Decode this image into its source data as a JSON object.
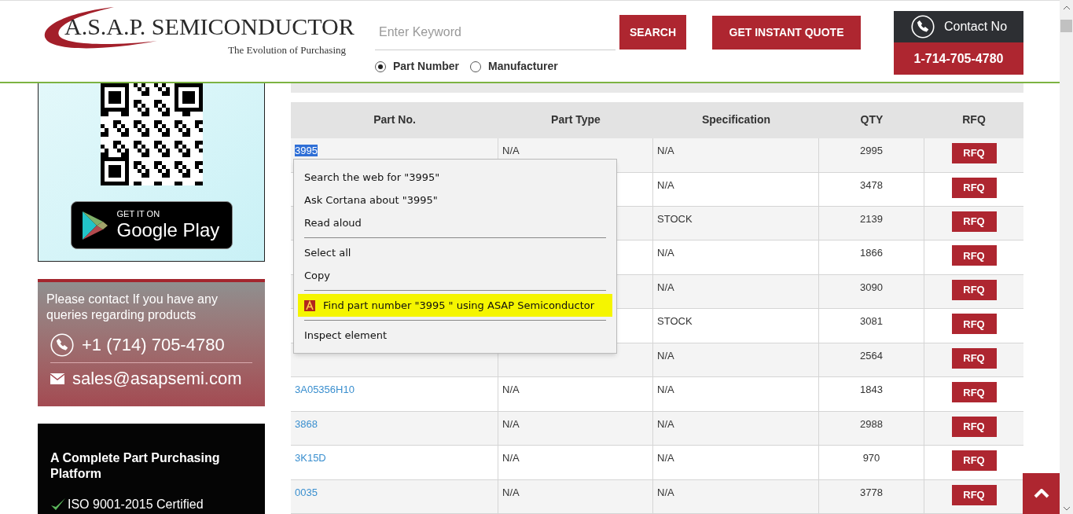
{
  "header": {
    "logo": {
      "name": "A.S.A.P. SEMICONDUCTOR",
      "tagline": "The Evolution of Purchasing"
    },
    "search": {
      "placeholder": "Enter Keyword",
      "button": "SEARCH",
      "options": [
        {
          "label": "Part Number",
          "selected": true
        },
        {
          "label": "Manufacturer",
          "selected": false
        }
      ]
    },
    "quote_button": "GET INSTANT QUOTE",
    "contact": {
      "label": "Contact No",
      "phone": "1-714-705-4780"
    }
  },
  "sidebar": {
    "app_badge": {
      "small": "GET IT ON",
      "large": "Google Play"
    },
    "contact_card": {
      "text": "Please contact If you have any queries regarding products",
      "phone": "+1 (714) 705-4780",
      "email": "sales@asapsemi.com"
    },
    "promo_card": {
      "title": "A Complete Part Purchasing Platform",
      "items": [
        "ISO 9001-2015 Certified"
      ]
    }
  },
  "table": {
    "columns": [
      "Part No.",
      "Part Type",
      "Specification",
      "QTY",
      "RFQ"
    ],
    "rows": [
      {
        "part": "3995",
        "part_selected": true,
        "type": "N/A",
        "spec": "N/A",
        "qty": "2995",
        "rfq": "RFQ"
      },
      {
        "spec": "N/A",
        "qty": "3478",
        "rfq": "RFQ"
      },
      {
        "spec": "STOCK",
        "qty": "2139",
        "rfq": "RFQ"
      },
      {
        "spec": "N/A",
        "qty": "1866",
        "rfq": "RFQ"
      },
      {
        "spec": "N/A",
        "qty": "3090",
        "rfq": "RFQ"
      },
      {
        "spec": "STOCK",
        "qty": "3081",
        "rfq": "RFQ"
      },
      {
        "spec": "N/A",
        "qty": "2564",
        "rfq": "RFQ"
      },
      {
        "part": "3A05356H10",
        "part_selected": false,
        "type": "N/A",
        "spec": "N/A",
        "qty": "1843",
        "rfq": "RFQ"
      },
      {
        "part": "3868",
        "part_selected": false,
        "type": "N/A",
        "spec": "N/A",
        "qty": "2988",
        "rfq": "RFQ"
      },
      {
        "part": "3K15D",
        "part_selected": false,
        "type": "N/A",
        "spec": "N/A",
        "qty": "970",
        "rfq": "RFQ"
      },
      {
        "part": "0035",
        "part_selected": false,
        "type": "N/A",
        "spec": "N/A",
        "qty": "3778",
        "rfq": "RFQ"
      }
    ]
  },
  "context_menu": {
    "items": [
      {
        "kind": "item",
        "label": "Search the web for \"3995\"",
        "highlighted": false
      },
      {
        "kind": "item",
        "label": "Ask Cortana about \"3995\"",
        "highlighted": false
      },
      {
        "kind": "item",
        "label": "Read aloud",
        "highlighted": false
      },
      {
        "kind": "separator"
      },
      {
        "kind": "item",
        "label": "Select all",
        "highlighted": false
      },
      {
        "kind": "item",
        "label": "Copy",
        "highlighted": false
      },
      {
        "kind": "separator"
      },
      {
        "kind": "extension",
        "label": "Find part number \"3995 \" using ASAP Semiconductor",
        "highlighted": true
      },
      {
        "kind": "separator"
      },
      {
        "kind": "item",
        "label": "Inspect element",
        "highlighted": false
      }
    ]
  }
}
